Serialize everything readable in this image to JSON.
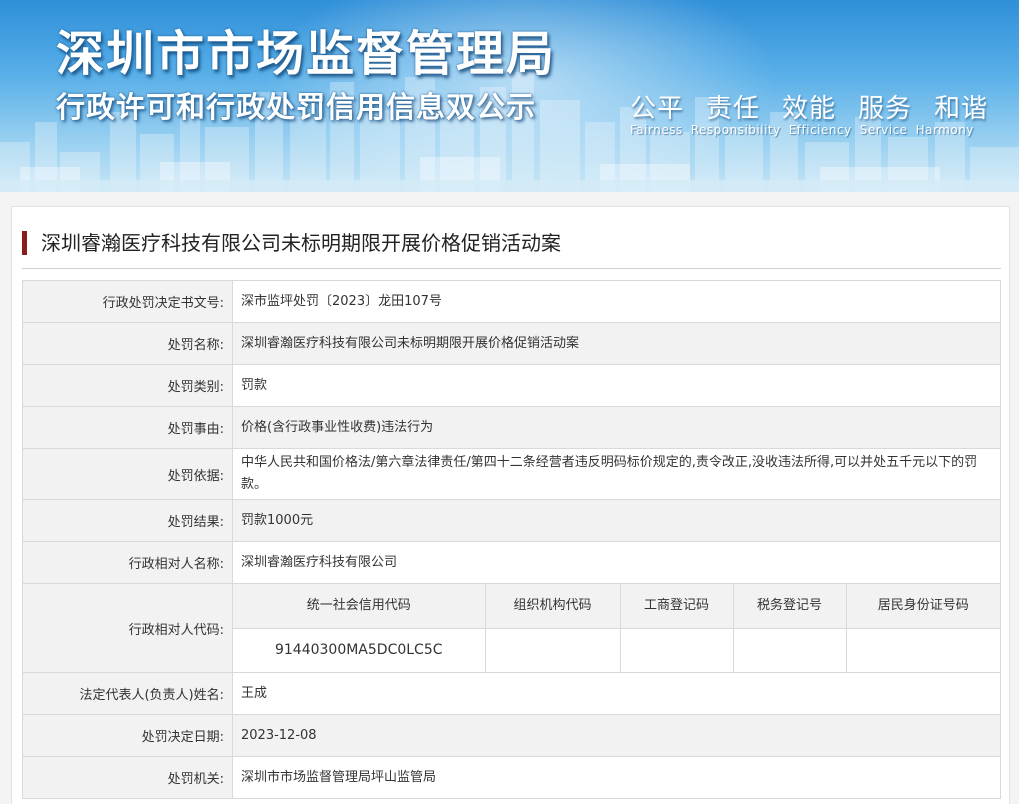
{
  "banner": {
    "title": "深圳市市场监督管理局",
    "subtitle": "行政许可和行政处罚信用信息双公示",
    "slogans_cn": [
      "公平",
      "责任",
      "效能",
      "服务",
      "和谐"
    ],
    "slogans_en": [
      "Fairness",
      "Responsibility",
      "Efficiency",
      "Service",
      "Harmony"
    ]
  },
  "case": {
    "title": "深圳睿瀚医疗科技有限公司未标明期限开展价格促销活动案"
  },
  "fields": {
    "decision_no": {
      "label": "行政处罚决定书文号:",
      "value": "深市监坪处罚〔2023〕龙田107号"
    },
    "penalty_name": {
      "label": "处罚名称:",
      "value": "深圳睿瀚医疗科技有限公司未标明期限开展价格促销活动案"
    },
    "penalty_type": {
      "label": "处罚类别:",
      "value": "罚款"
    },
    "penalty_reason": {
      "label": "处罚事由:",
      "value": "价格(含行政事业性收费)违法行为"
    },
    "penalty_basis": {
      "label": "处罚依据:",
      "value": "中华人民共和国价格法/第六章法律责任/第四十二条经营者违反明码标价规定的,责令改正,没收违法所得,可以并处五千元以下的罚款。"
    },
    "penalty_result": {
      "label": "处罚结果:",
      "value": "罚款1000元"
    },
    "party_name": {
      "label": "行政相对人名称:",
      "value": "深圳睿瀚医疗科技有限公司"
    },
    "party_code": {
      "label": "行政相对人代码:",
      "headers": [
        "统一社会信用代码",
        "组织机构代码",
        "工商登记码",
        "税务登记号",
        "居民身份证号码"
      ],
      "values": [
        "91440300MA5DC0LC5C",
        "",
        "",
        "",
        ""
      ]
    },
    "legal_rep": {
      "label": "法定代表人(负责人)姓名:",
      "value": "王成"
    },
    "decision_date": {
      "label": "处罚决定日期:",
      "value": "2023-12-08"
    },
    "authority": {
      "label": "处罚机关:",
      "value": "深圳市市场监督管理局坪山监管局"
    }
  }
}
